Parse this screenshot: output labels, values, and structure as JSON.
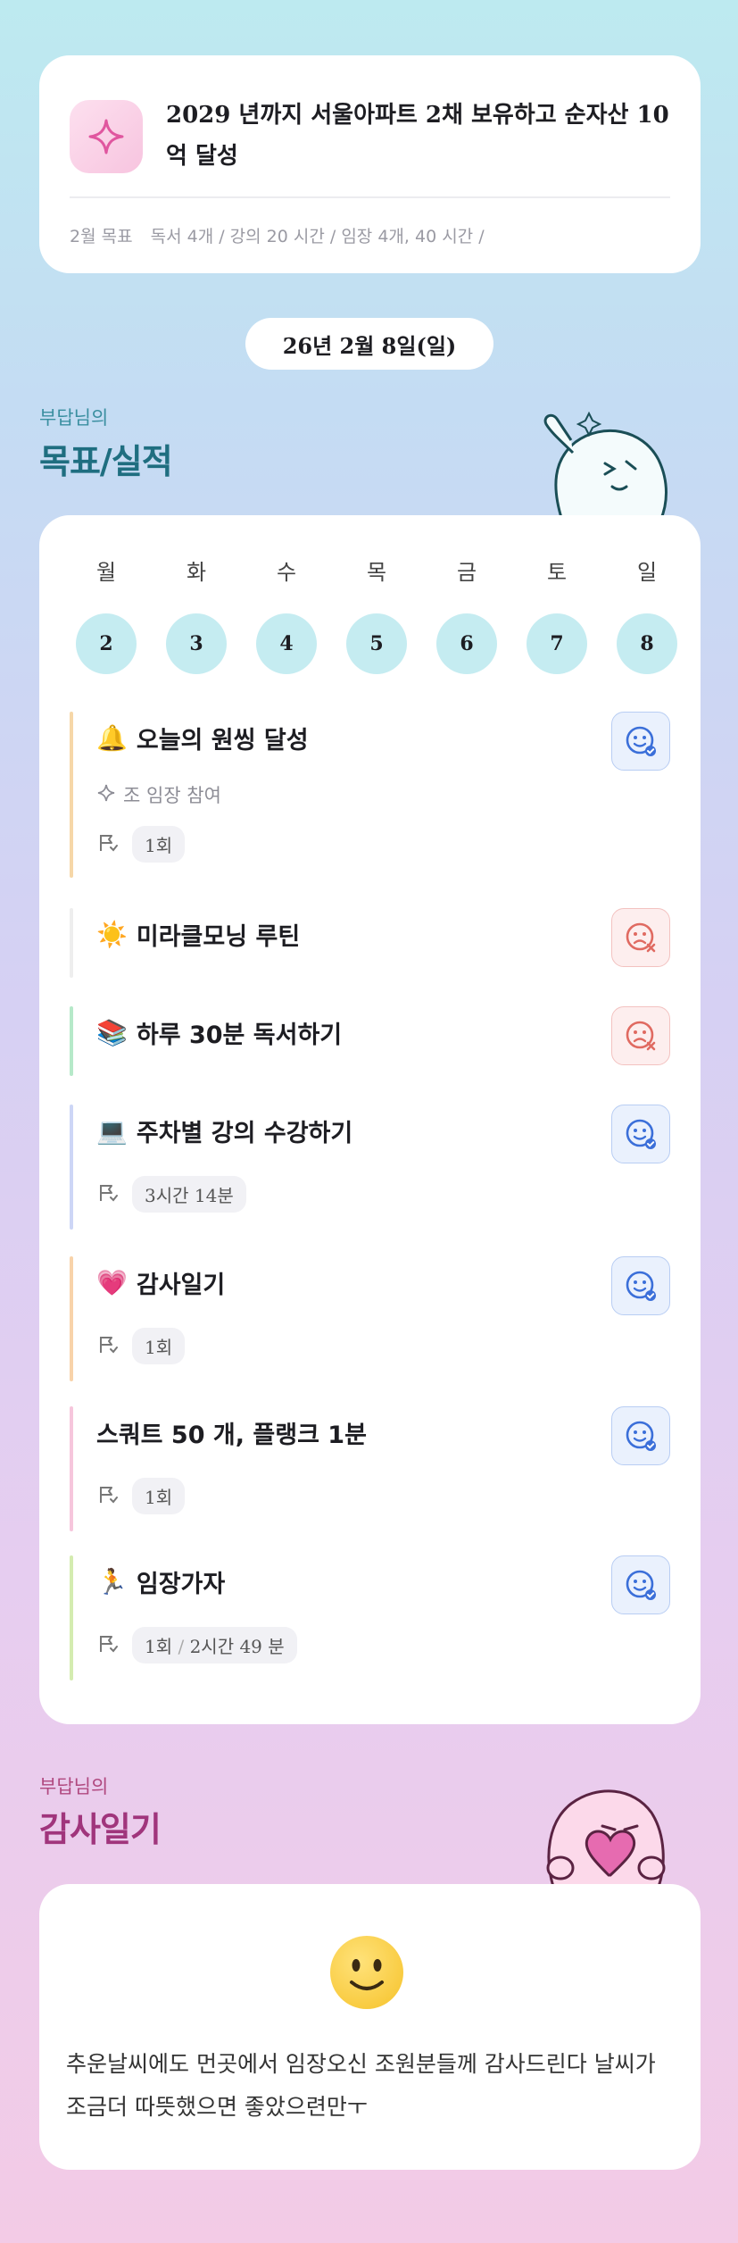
{
  "goal": {
    "icon": "sparkle-icon",
    "title": "2029 년까지 서울아파트 2채 보유하고 순자산 10억 달성",
    "month_label": "2월 목표",
    "month_text": "독서 4개 / 강의 20 시간 / 임장 4개, 40 시간 /"
  },
  "date_pill": "26년 2월 8일(일)",
  "section_goals": {
    "sub": "부답님의",
    "title": "목표/실적"
  },
  "week": {
    "days": [
      "월",
      "화",
      "수",
      "목",
      "금",
      "토",
      "일"
    ],
    "dates": [
      "2",
      "3",
      "4",
      "5",
      "6",
      "7",
      "8"
    ]
  },
  "habits": [
    {
      "emoji": "🔔",
      "title": "오늘의 원씽 달성",
      "sub": "조 임장 참여",
      "meta": [
        "1회"
      ],
      "mood": "good",
      "bar": "#f6d7a8"
    },
    {
      "emoji": "☀️",
      "title": "미라클모닝 루틴",
      "meta": [],
      "mood": "bad",
      "bar": "#eeeeee"
    },
    {
      "emoji": "📚",
      "title": "하루 30분 독서하기",
      "meta": [],
      "mood": "bad",
      "bar": "#b6e9c9"
    },
    {
      "emoji": "💻",
      "title": "주차별 강의 수강하기",
      "meta": [
        "3시간 14분"
      ],
      "mood": "good",
      "bar": "#cdd6f6"
    },
    {
      "emoji": "💗",
      "title": "감사일기",
      "meta": [
        "1회"
      ],
      "mood": "good",
      "bar": "#f8d3aa"
    },
    {
      "emoji": "",
      "title": "스쿼트 50 개, 플랭크 1분",
      "meta": [
        "1회"
      ],
      "mood": "good",
      "bar": "#f6c6dc"
    },
    {
      "emoji": "🏃",
      "title": "임장가자",
      "meta": [
        "1회",
        "2시간 49 분"
      ],
      "mood": "good",
      "bar": "#d4ecb0"
    }
  ],
  "section_thanks": {
    "sub": "부답님의",
    "title": "감사일기"
  },
  "thanks": {
    "emoji": "slightly-smiling-face-icon",
    "text": "추운날씨에도 먼곳에서 임장오신 조원분들께 감사드린다 날씨가 조금더 따뜻했으면 좋았으련만ㅜ"
  },
  "colors": {
    "goals_title": "#1f6e80",
    "goals_sub": "#3a8fa0",
    "thanks_title": "#a0357c",
    "thanks_sub": "#b0487f",
    "good": "#3b6fd9",
    "bad": "#e06a61"
  }
}
